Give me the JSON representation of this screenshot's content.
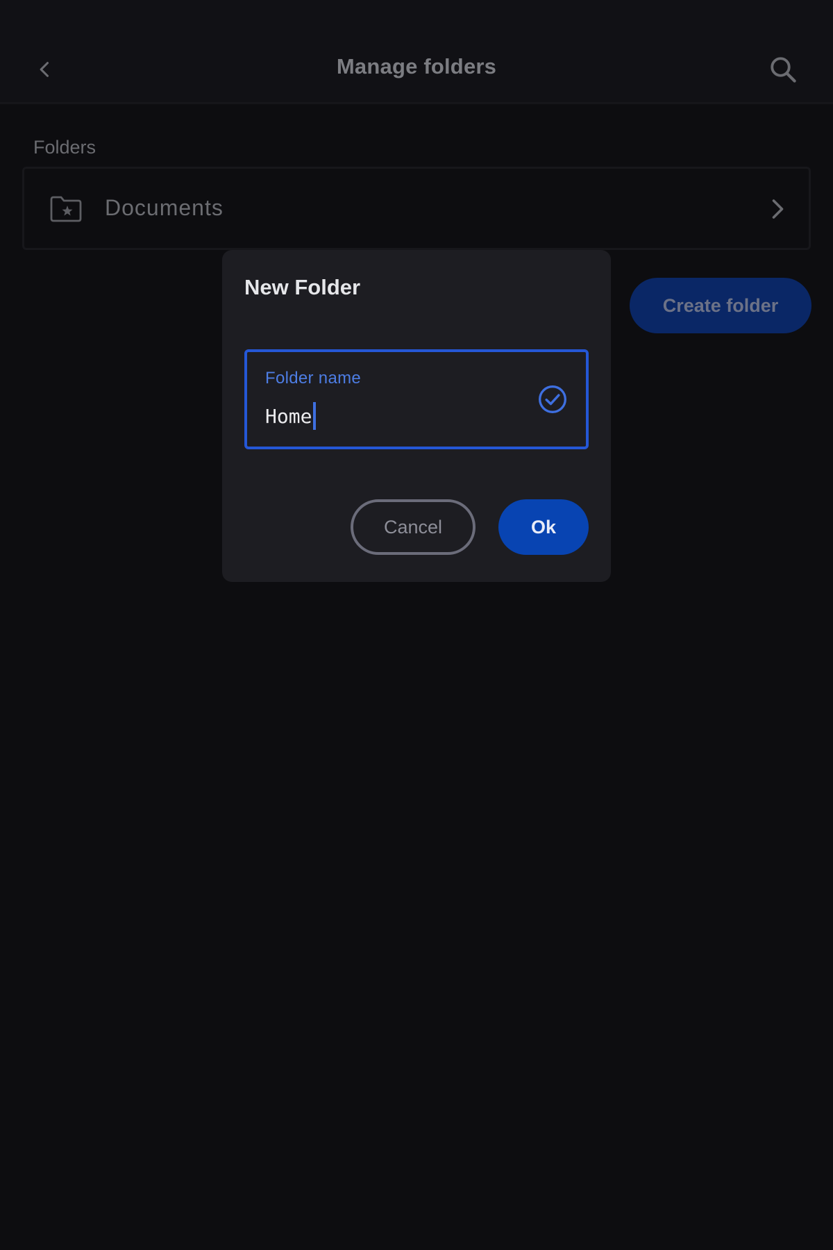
{
  "header": {
    "title": "Manage folders",
    "back_icon": "chevron-left-icon",
    "search_icon": "search-icon"
  },
  "folders": {
    "section_label": "Folders",
    "items": [
      {
        "label": "Documents",
        "icon": "folder-star-icon"
      }
    ]
  },
  "create_folder_label": "Create folder",
  "dialog": {
    "title": "New Folder",
    "field": {
      "label": "Folder name",
      "value": "Home",
      "status_icon": "check-circle-icon"
    },
    "cancel_label": "Cancel",
    "ok_label": "Ok"
  },
  "colors": {
    "background": "#0d0d10",
    "dialog_surface": "#1d1d22",
    "accent": "#2557d6",
    "primary_button": "#0844b2"
  }
}
